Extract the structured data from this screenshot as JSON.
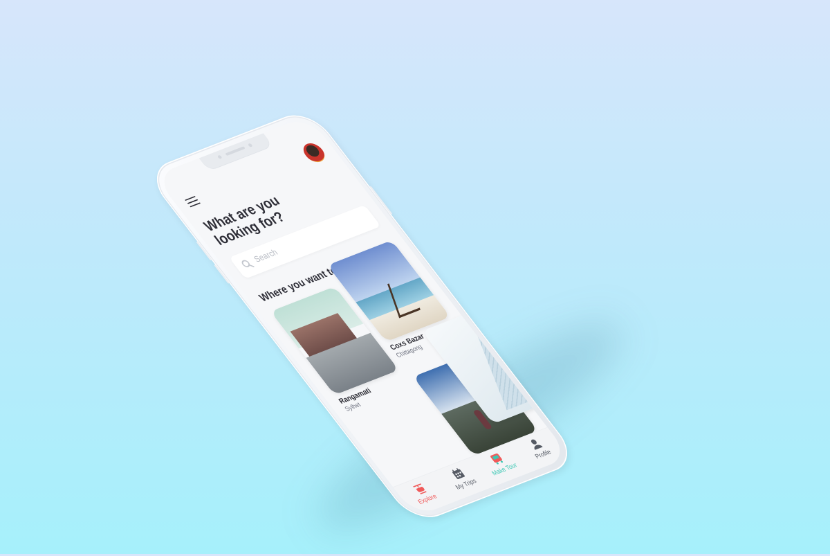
{
  "app": {
    "heading": "What are you looking for?",
    "search_placeholder": "Search",
    "section_title": "Where you want to go"
  },
  "destinations": [
    {
      "name": "Rangamati",
      "region": "Sylhet"
    },
    {
      "name": "Coxs Bazar",
      "region": "Chittagong"
    }
  ],
  "tabs": [
    {
      "label": "Explore",
      "icon": "helicopter-icon",
      "color": "#f05a5a"
    },
    {
      "label": "My Trips",
      "icon": "calendar-icon",
      "color": "#555a64"
    },
    {
      "label": "Make Tour",
      "icon": "bus-icon",
      "color": "#3cc8b4"
    },
    {
      "label": "Profile",
      "icon": "user-icon",
      "color": "#555a64"
    }
  ],
  "colors": {
    "accent_red": "#f05a5a",
    "accent_teal": "#3cc8b4",
    "text_dark": "#2e2e37"
  }
}
